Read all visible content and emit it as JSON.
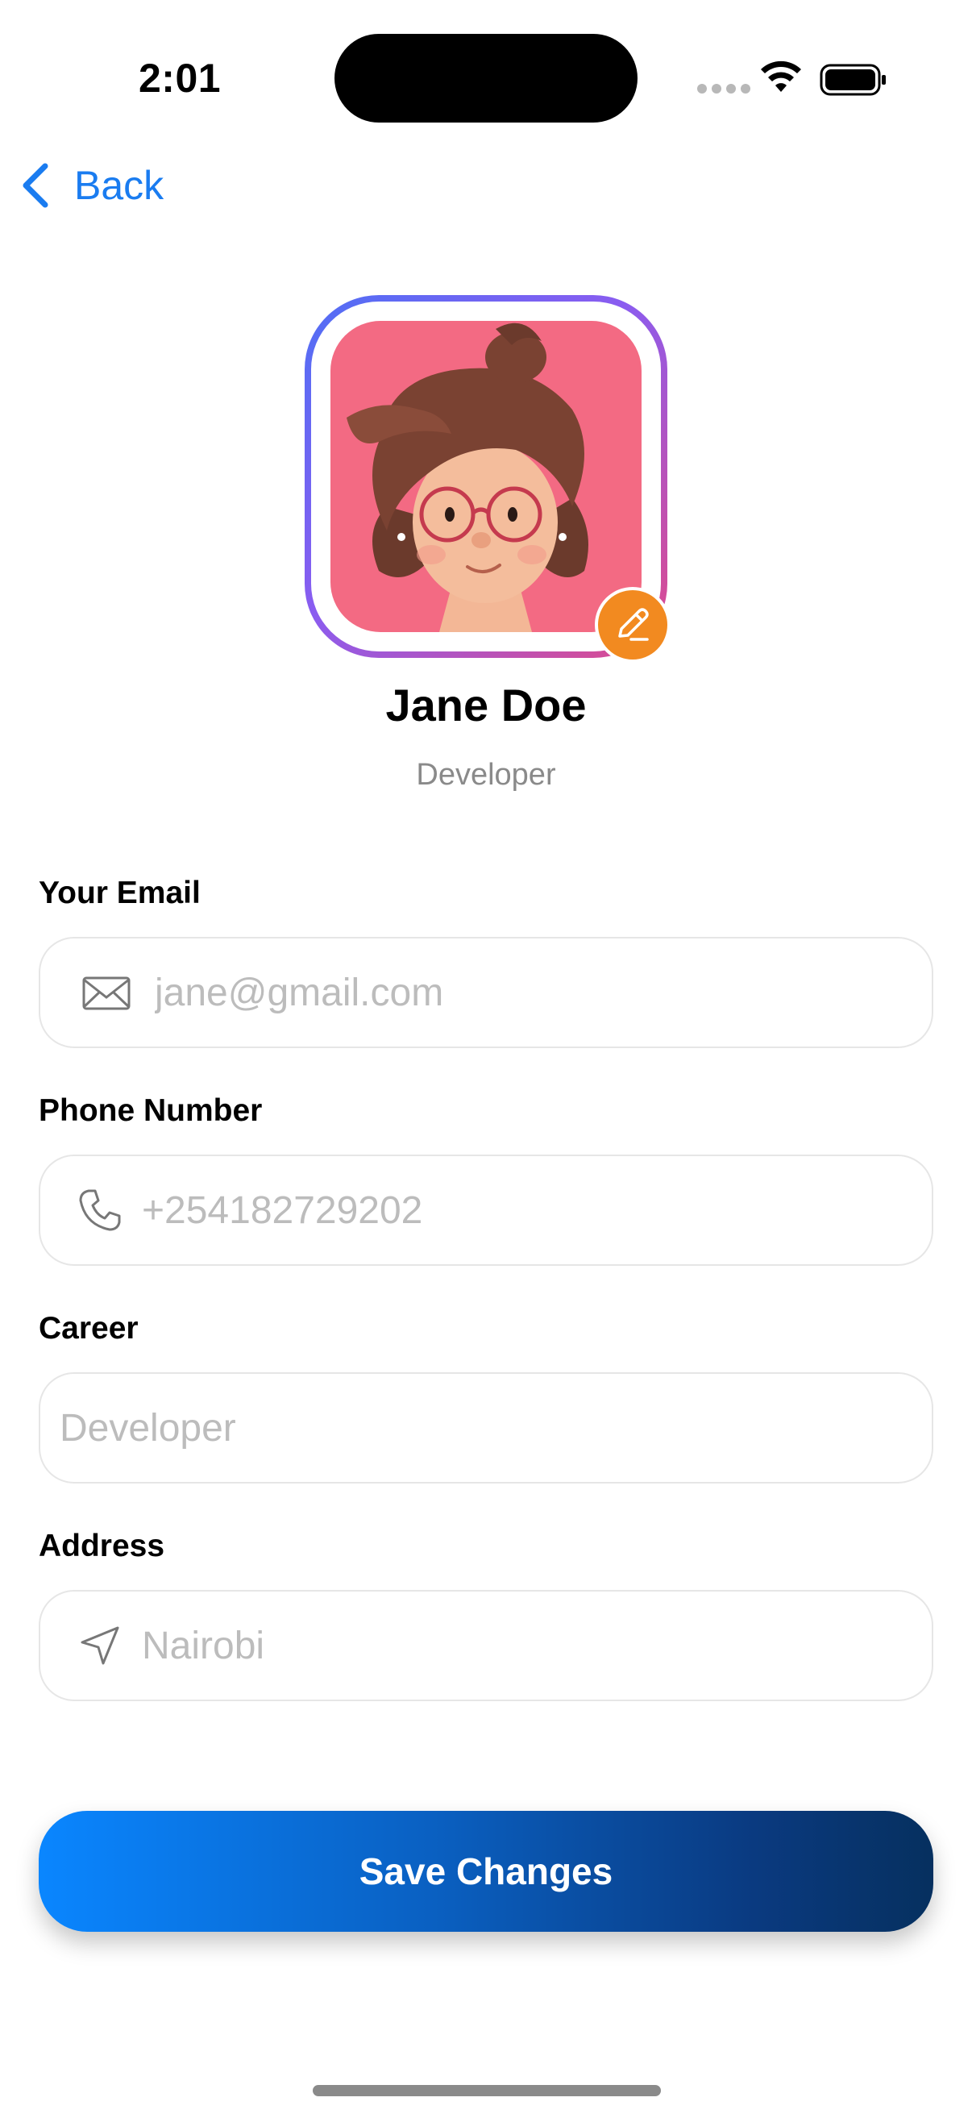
{
  "status_bar": {
    "time": "2:01"
  },
  "nav": {
    "back_label": "Back"
  },
  "profile": {
    "name": "Jane Doe",
    "role": "Developer"
  },
  "form": {
    "email": {
      "label": "Your Email",
      "placeholder": "jane@gmail.com",
      "icon": "mail-icon"
    },
    "phone": {
      "label": "Phone Number",
      "placeholder": "+254182729202",
      "icon": "phone-icon"
    },
    "career": {
      "label": "Career",
      "placeholder": "Developer"
    },
    "address": {
      "label": "Address",
      "placeholder": "Nairobi",
      "icon": "location-arrow-icon"
    }
  },
  "actions": {
    "save_label": "Save Changes"
  },
  "colors": {
    "accent": "#1a7cf0",
    "avatar_bg": "#f36a83",
    "edit_badge": "#f28a20",
    "button_start": "#0a86ff",
    "button_end": "#06305f"
  }
}
